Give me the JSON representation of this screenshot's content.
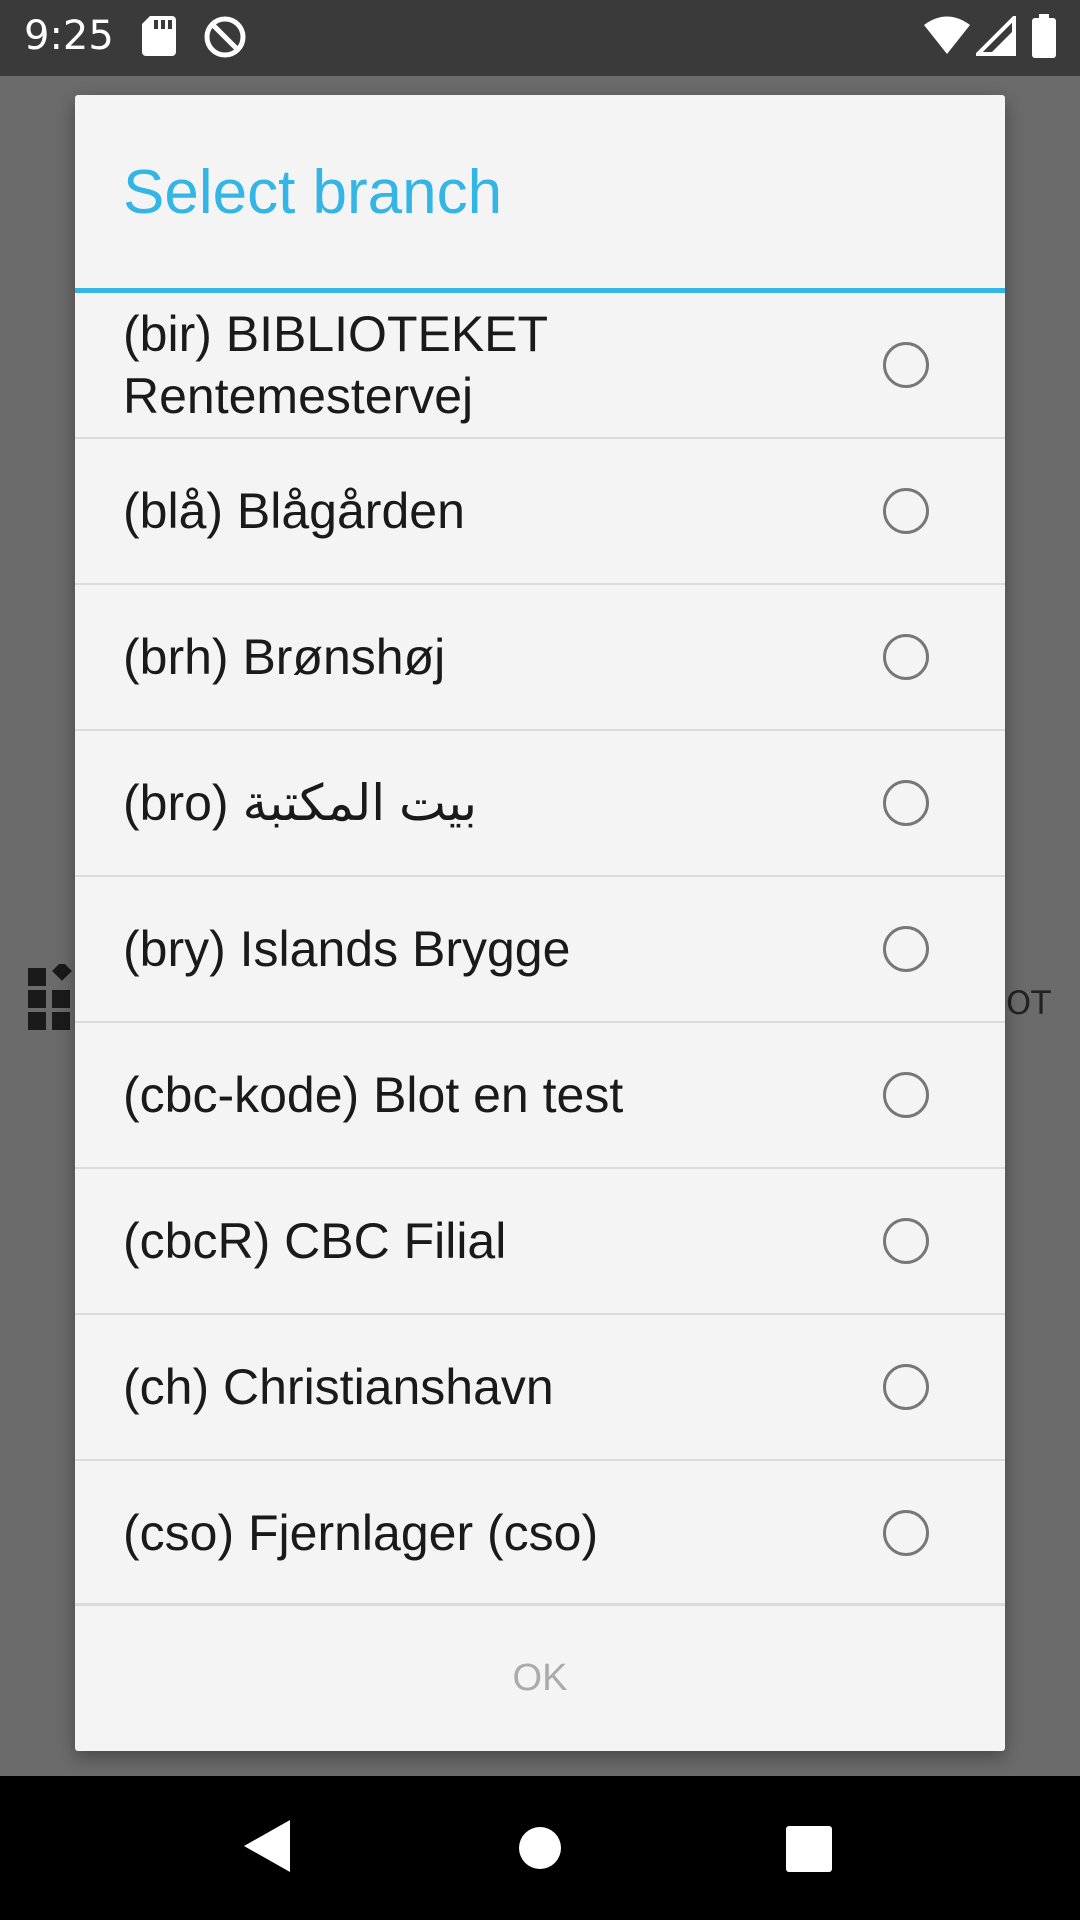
{
  "status_bar": {
    "time": "9:25"
  },
  "background": {
    "label_fragment": "OT"
  },
  "dialog": {
    "title": "Select branch",
    "items": [
      {
        "label": "(bir) BIBLIOTEKET Rentemestervej",
        "selected": false
      },
      {
        "label": "(blå) Blågården",
        "selected": false
      },
      {
        "label": "(brh) Brønshøj",
        "selected": false
      },
      {
        "label": "(bro) بيت المكتبة",
        "selected": false
      },
      {
        "label": "(bry) Islands Brygge",
        "selected": false
      },
      {
        "label": "(cbc-kode) Blot en test",
        "selected": false
      },
      {
        "label": "(cbcR) CBC Filial",
        "selected": false
      },
      {
        "label": "(ch) Christianshavn",
        "selected": false
      },
      {
        "label": "(cso) Fjernlager (cso)",
        "selected": false
      }
    ],
    "ok_label": "OK"
  },
  "colors": {
    "accent": "#33b5e5",
    "dialog_bg": "#f4f4f4",
    "scrim": "#6b6b6b"
  }
}
